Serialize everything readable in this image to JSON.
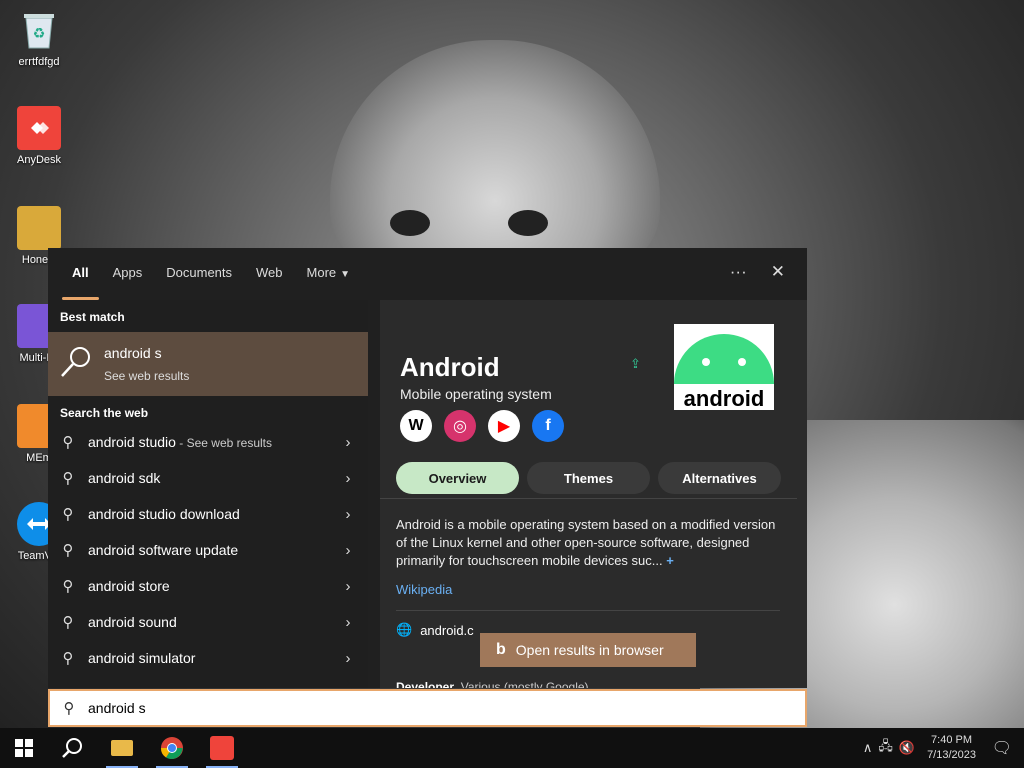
{
  "desktop": {
    "icons": [
      {
        "label": "errtfdfgd",
        "icon": "recycle-bin-icon"
      },
      {
        "label": "AnyDesk",
        "icon": "anydesk-icon"
      },
      {
        "label": "Honew",
        "icon": "folder-icon"
      },
      {
        "label": "Multi-IM",
        "icon": "app-icon"
      },
      {
        "label": "MEm",
        "icon": "memu-icon"
      },
      {
        "label": "TeamVie",
        "icon": "teamviewer-icon"
      }
    ]
  },
  "search": {
    "tabs": [
      "All",
      "Apps",
      "Documents",
      "Web",
      "More"
    ],
    "more_caret": "▼",
    "tools": {
      "more": "···",
      "close": "✕"
    },
    "best_match_title": "Best match",
    "best_match": {
      "title": "android s",
      "subtitle": "See web results"
    },
    "search_web_title": "Search the web",
    "suggestions": [
      {
        "prefix": "android ",
        "bold": "studio",
        "sub": " - See web results"
      },
      {
        "prefix": "android ",
        "bold": "sdk",
        "sub": ""
      },
      {
        "prefix": "android ",
        "bold": "studio download",
        "sub": ""
      },
      {
        "prefix": "android ",
        "bold": "software update",
        "sub": ""
      },
      {
        "prefix": "android ",
        "bold": "store",
        "sub": ""
      },
      {
        "prefix": "android ",
        "bold": "sound",
        "sub": ""
      },
      {
        "prefix": "android ",
        "bold": "simulator",
        "sub": ""
      }
    ],
    "query": "android s"
  },
  "preview": {
    "title": "Android",
    "subtitle": "Mobile operating system",
    "logo_text": "android",
    "socials": [
      {
        "name": "wikipedia-icon",
        "glyph": "W",
        "bg": "#ffffff",
        "fg": "#000000"
      },
      {
        "name": "instagram-icon",
        "glyph": "◎",
        "bg": "#d6336c",
        "fg": "#ffffff"
      },
      {
        "name": "youtube-icon",
        "glyph": "▶",
        "bg": "#ffffff",
        "fg": "#ff0000"
      },
      {
        "name": "facebook-icon",
        "glyph": "f",
        "bg": "#1877f2",
        "fg": "#ffffff"
      }
    ],
    "pills": [
      "Overview",
      "Themes",
      "Alternatives"
    ],
    "description": "Android is a mobile operating system based on a modified version of the Linux kernel and other open-source software, designed primarily for touchscreen mobile devices suc...",
    "description_more": "+",
    "wiki_link": "Wikipedia",
    "site": "android.c",
    "developer_label": "Developer",
    "developer_value": "Various (mostly Google)",
    "open_button": "Open results in browser"
  },
  "taskbar": {
    "time": "7:40 PM",
    "date": "7/13/2023"
  },
  "colors": {
    "accent": "#e8a66a",
    "best_match_bg": "#5d4c3f",
    "pill_active": "#c7e8c6"
  }
}
